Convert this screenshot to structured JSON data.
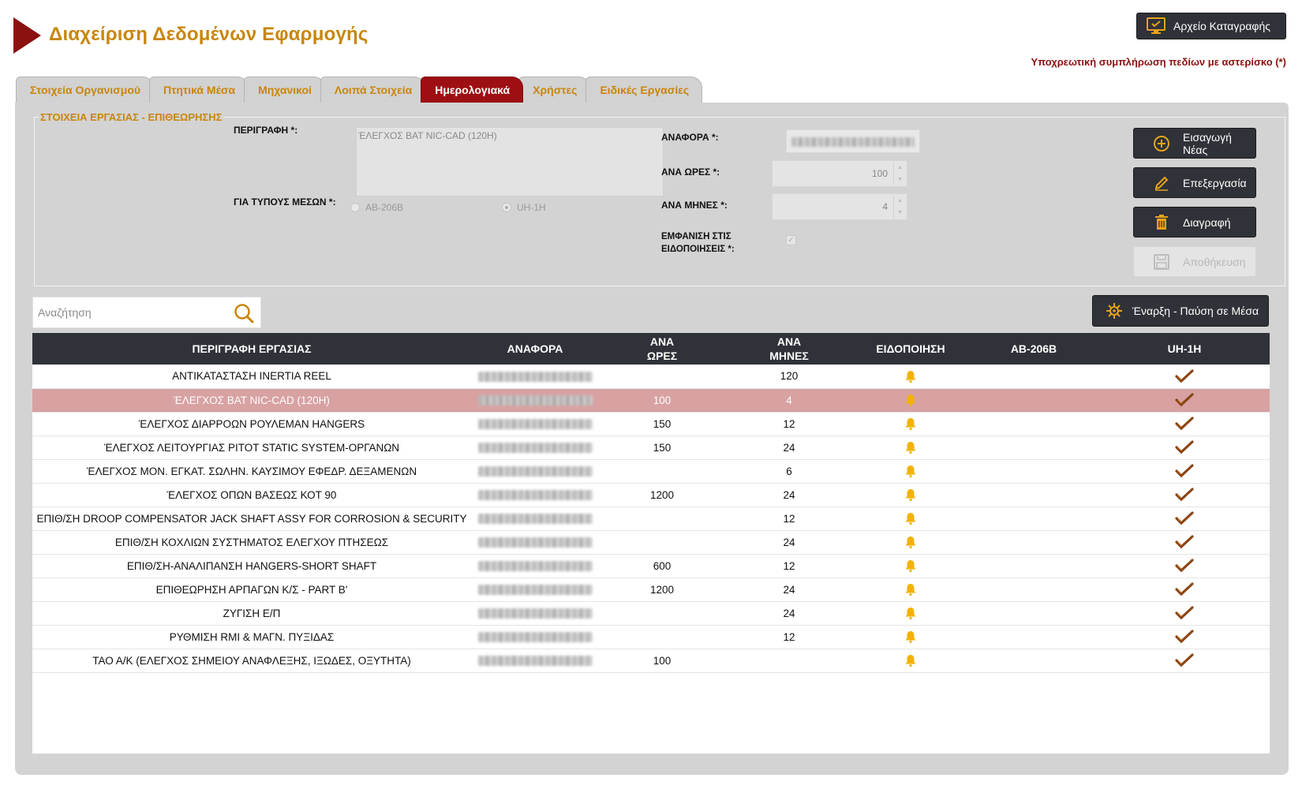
{
  "app": {
    "title": "Διαχείριση Δεδομένων Εφαρμογής",
    "log_button": "Αρχείο Καταγραφής",
    "required_note": "Υποχρεωτική συμπλήρωση πεδίων με αστερίσκο (*)"
  },
  "tabs": [
    {
      "label": "Στοιχεία Οργανισμού",
      "active": false
    },
    {
      "label": "Πτητικά Μέσα",
      "active": false
    },
    {
      "label": "Μηχανικοί",
      "active": false
    },
    {
      "label": "Λοιπά Στοιχεία",
      "active": false
    },
    {
      "label": "Ημερολογιακά",
      "active": true
    },
    {
      "label": "Χρήστες",
      "active": false
    },
    {
      "label": "Ειδικές Εργασίες",
      "active": false
    }
  ],
  "form": {
    "legend": "ΣΤΟΙΧΕΙΑ ΕΡΓΑΣΙΑΣ - ΕΠΙΘΕΩΡΗΣΗΣ",
    "description_label": "ΠΕΡΙΓΡΑΦΗ *:",
    "description_value": "ΈΛΕΓΧΟΣ BAT NIC-CAD (120H)",
    "vehicle_types_label": "ΓΙΑ ΤΥΠΟΥΣ ΜΕΣΩΝ *:",
    "vehicle_types": [
      {
        "label": "AB-206B",
        "selected": false
      },
      {
        "label": "UH-1H",
        "selected": true
      }
    ],
    "reference_label": "ΑΝΑΦΟΡΑ *:",
    "hours_label": "ΑΝΑ ΩΡΕΣ *:",
    "hours_value": "100",
    "months_label": "ΑΝΑ ΜΗΝΕΣ *:",
    "months_value": "4",
    "notify_label_line1": "ΕΜΦΑΝΙΣΗ ΣΤΙΣ",
    "notify_label_line2": "ΕΙΔΟΠΟΙΗΣΕΙΣ *:",
    "notify_checked": true
  },
  "actions": {
    "new": "Εισαγωγή Νέας",
    "edit": "Επεξεργασία",
    "delete": "Διαγραφή",
    "save": "Αποθήκευση",
    "start_stop": "Έναρξη - Παύση σε Μέσα"
  },
  "search": {
    "placeholder": "Αναζήτηση"
  },
  "table": {
    "headers": {
      "description": "ΠΕΡΙΓΡΑΦΗ ΕΡΓΑΣΙΑΣ",
      "reference": "ΑΝΑΦΟΡΑ",
      "hours_line1": "ΑΝΑ",
      "hours_line2": "ΩΡΕΣ",
      "months_line1": "ΑΝΑ",
      "months_line2": "ΜΗΝΕΣ",
      "notification": "ΕΙΔΟΠΟΙΗΣΗ",
      "ab206b": "AB-206B",
      "uh1h": "UH-1H"
    },
    "rows": [
      {
        "description": "ΑΝΤΙΚΑΤΑΣΤΑΣΗ INERTIA REEL",
        "hours": "",
        "months": "120",
        "notify": true,
        "ab206b": false,
        "uh1h": true,
        "selected": false
      },
      {
        "description": "ΈΛΕΓΧΟΣ BAT NIC-CAD (120H)",
        "hours": "100",
        "months": "4",
        "notify": true,
        "ab206b": false,
        "uh1h": true,
        "selected": true
      },
      {
        "description": "ΈΛΕΓΧΟΣ ΔΙΑΡΡΟΩΝ ΡΟΥΛΕΜΑΝ HANGERS",
        "hours": "150",
        "months": "12",
        "notify": true,
        "ab206b": false,
        "uh1h": true,
        "selected": false
      },
      {
        "description": "ΈΛΕΓΧΟΣ ΛΕΙΤΟΥΡΓΙΑΣ PITOT STATIC SYSTEM-ΟΡΓΑΝΩΝ",
        "hours": "150",
        "months": "24",
        "notify": true,
        "ab206b": false,
        "uh1h": true,
        "selected": false
      },
      {
        "description": "ΈΛΕΓΧΟΣ ΜΟΝ. ΕΓΚΑΤ. ΣΩΛΗΝ. ΚΑΥΣΙΜΟΥ ΕΦΕΔΡ. ΔΕΞΑΜΕΝΩΝ",
        "hours": "",
        "months": "6",
        "notify": true,
        "ab206b": false,
        "uh1h": true,
        "selected": false
      },
      {
        "description": "ΈΛΕΓΧΟΣ ΟΠΩΝ ΒΑΣΕΩΣ ΚΟΤ 90",
        "hours": "1200",
        "months": "24",
        "notify": true,
        "ab206b": false,
        "uh1h": true,
        "selected": false
      },
      {
        "description": "ΕΠΙΘ/ΣΗ DROOP COMPENSATOR JACK SHAFT ASSY FOR CORROSION & SECURITY",
        "hours": "",
        "months": "12",
        "notify": true,
        "ab206b": false,
        "uh1h": true,
        "selected": false
      },
      {
        "description": "ΕΠΙΘ/ΣΗ ΚΟΧΛΙΩΝ ΣΥΣΤΗΜΑΤΟΣ ΕΛΕΓΧΟΥ ΠΤΗΣΕΩΣ",
        "hours": "",
        "months": "24",
        "notify": true,
        "ab206b": false,
        "uh1h": true,
        "selected": false
      },
      {
        "description": "ΕΠΙΘ/ΣΗ-ΑΝΑΛΙΠΑΝΣΗ HANGERS-SHORT SHAFT",
        "hours": "600",
        "months": "12",
        "notify": true,
        "ab206b": false,
        "uh1h": true,
        "selected": false
      },
      {
        "description": "ΕΠΙΘΕΩΡΗΣΗ ΑΡΠΑΓΩΝ Κ/Σ - PART B'",
        "hours": "1200",
        "months": "24",
        "notify": true,
        "ab206b": false,
        "uh1h": true,
        "selected": false
      },
      {
        "description": "ΖΥΓΙΣΗ Ε/Π",
        "hours": "",
        "months": "24",
        "notify": true,
        "ab206b": false,
        "uh1h": true,
        "selected": false
      },
      {
        "description": "ΡΥΘΜΙΣΗ RMI & ΜΑΓΝ. ΠΥΞΙΔΑΣ",
        "hours": "",
        "months": "12",
        "notify": true,
        "ab206b": false,
        "uh1h": true,
        "selected": false
      },
      {
        "description": "ΤΑΟ Α/Κ (ΕΛΕΓΧΟΣ ΣΗΜΕΙΟΥ ΑΝΑΦΛΕΞΗΣ, ΙΞΩΔΕΣ, ΟΞΥΤΗΤΑ)",
        "hours": "100",
        "months": "",
        "notify": true,
        "ab206b": false,
        "uh1h": true,
        "selected": false
      }
    ]
  },
  "colors": {
    "brand": "#c8860c",
    "accent_red": "#9e0f14",
    "dark_button": "#2f3238",
    "selected_row": "#d8a1a2",
    "bell": "#f2b300",
    "tick": "#8b4513"
  }
}
